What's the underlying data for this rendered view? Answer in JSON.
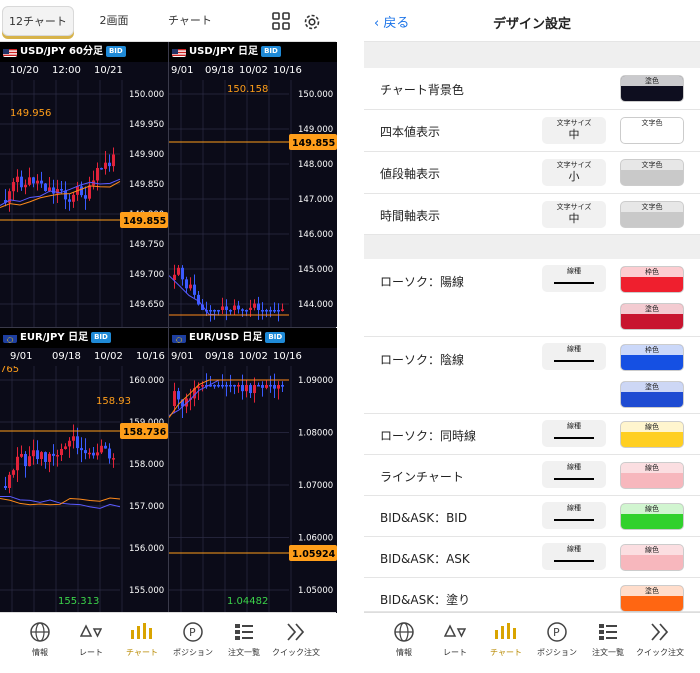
{
  "left": {
    "tabs": [
      {
        "label": "12チャート"
      },
      {
        "label": "2画面"
      },
      {
        "label": "チャート"
      }
    ],
    "panels": [
      {
        "pair": "USD/JPY",
        "period": "60分足",
        "bid": "BID",
        "flag": "us",
        "xlabels": [
          "10/20",
          "12:00",
          "10/21"
        ],
        "yticks": [
          "150.000",
          "149.950",
          "149.900",
          "149.850",
          "149.800",
          "149.750",
          "149.700",
          "149.650"
        ],
        "price": "149.855",
        "hi": "149.956"
      },
      {
        "pair": "USD/JPY",
        "period": "日足",
        "bid": "BID",
        "flag": "us",
        "xlabels": [
          "9/01",
          "09/18",
          "10/02",
          "10/16"
        ],
        "yticks": [
          "150.000",
          "149.000",
          "148.000",
          "147.000",
          "146.000",
          "145.000",
          "144.000"
        ],
        "price": "149.855",
        "hi": "150.158"
      },
      {
        "pair": "EUR/JPY",
        "period": "日足",
        "bid": "BID",
        "flag": "eu",
        "xlabels": [
          "9/01",
          "09/18",
          "10/02",
          "10/16"
        ],
        "yticks": [
          "160.000",
          "159.000",
          "158.000",
          "157.000",
          "156.000",
          "155.000"
        ],
        "price": "158.736",
        "hi": "158.93",
        "lo": "155.313",
        "left": "765"
      },
      {
        "pair": "EUR/USD",
        "period": "日足",
        "bid": "BID",
        "flag": "eu",
        "xlabels": [
          "9/01",
          "09/18",
          "10/02",
          "10/16"
        ],
        "yticks": [
          "1.09000",
          "1.08000",
          "1.07000",
          "1.06000",
          "1.05000"
        ],
        "price": "1.05924",
        "lo": "1.04482"
      }
    ],
    "nav": [
      {
        "label": "情報"
      },
      {
        "label": "レート"
      },
      {
        "label": "チャート"
      },
      {
        "label": "ポジション"
      },
      {
        "label": "注文一覧"
      },
      {
        "label": "クイック注文"
      }
    ]
  },
  "right": {
    "back": "戻る",
    "title": "デザイン設定",
    "colors": {
      "accent": "#1a73e8",
      "gold": "#d7b34a"
    },
    "rows": [
      {
        "label": "チャート背景色",
        "swatches": [
          {
            "title": "塗色",
            "color": "#0e0e1f"
          }
        ]
      },
      {
        "label": "四本値表示",
        "size": {
          "title": "文字サイズ",
          "value": "中"
        },
        "swatches": [
          {
            "title": "文字色",
            "color": "#ffffff"
          }
        ]
      },
      {
        "label": "値段軸表示",
        "size": {
          "title": "文字サイズ",
          "value": "小"
        },
        "swatches": [
          {
            "title": "文字色",
            "color": "#c9c9c9"
          }
        ]
      },
      {
        "label": "時間軸表示",
        "size": {
          "title": "文字サイズ",
          "value": "中"
        },
        "swatches": [
          {
            "title": "文字色",
            "color": "#c9c9c9"
          }
        ]
      },
      {
        "label": "ローソク：陽線",
        "line": {
          "title": "線種"
        },
        "swatches": [
          {
            "title": "枠色",
            "color": "#ef1f2e"
          },
          {
            "title": "塗色",
            "color": "#c8152f"
          }
        ]
      },
      {
        "label": "ローソク：陰線",
        "line": {
          "title": "線種"
        },
        "swatches": [
          {
            "title": "枠色",
            "color": "#1550e3"
          },
          {
            "title": "塗色",
            "color": "#1e4bd2"
          }
        ]
      },
      {
        "label": "ローソク：同時線",
        "line": {
          "title": "線種"
        },
        "swatches": [
          {
            "title": "線色",
            "color": "#ffcf22"
          }
        ]
      },
      {
        "label": "ラインチャート",
        "line": {
          "title": "線種"
        },
        "swatches": [
          {
            "title": "線色",
            "color": "#f7b7bd"
          }
        ]
      },
      {
        "label": "BID&ASK：BID",
        "line": {
          "title": "線種"
        },
        "swatches": [
          {
            "title": "線色",
            "color": "#31d12c"
          }
        ]
      },
      {
        "label": "BID&ASK：ASK",
        "line": {
          "title": "線種"
        },
        "swatches": [
          {
            "title": "線色",
            "color": "#f7b7bd"
          }
        ]
      },
      {
        "label": "BID&ASK：塗り",
        "swatches": [
          {
            "title": "塗色",
            "color": "#ff6612"
          }
        ]
      }
    ],
    "nav": [
      {
        "label": "情報"
      },
      {
        "label": "レート"
      },
      {
        "label": "チャート"
      },
      {
        "label": "ポジション"
      },
      {
        "label": "注文一覧"
      },
      {
        "label": "クイック注文"
      }
    ]
  }
}
